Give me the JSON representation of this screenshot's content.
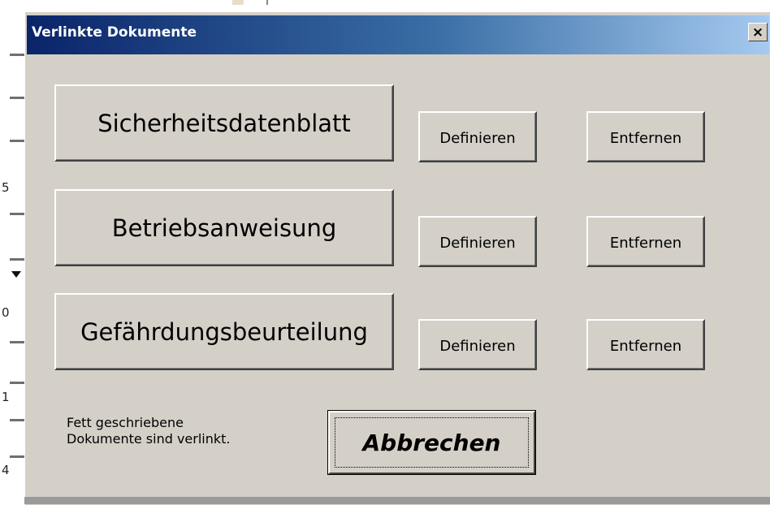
{
  "window": {
    "title": "Verlinkte Dokumente",
    "close_label": "×"
  },
  "documents": [
    {
      "label": "Sicherheitsdatenblatt",
      "define_label": "Definieren",
      "remove_label": "Entfernen"
    },
    {
      "label": "Betriebsanweisung",
      "define_label": "Definieren",
      "remove_label": "Entfernen"
    },
    {
      "label": "Gefährdungsbeurteilung",
      "define_label": "Definieren",
      "remove_label": "Entfernen"
    }
  ],
  "note": {
    "line1": "Fett geschriebene",
    "line2": "Dokumente sind verlinkt."
  },
  "cancel_label": "Abbrechen",
  "background": {
    "row_chars": [
      "5",
      "0",
      "1",
      "4"
    ]
  },
  "colors": {
    "dialog_bg": "#d4d0c8",
    "title_start": "#0a246a",
    "title_end": "#a6caf0"
  }
}
